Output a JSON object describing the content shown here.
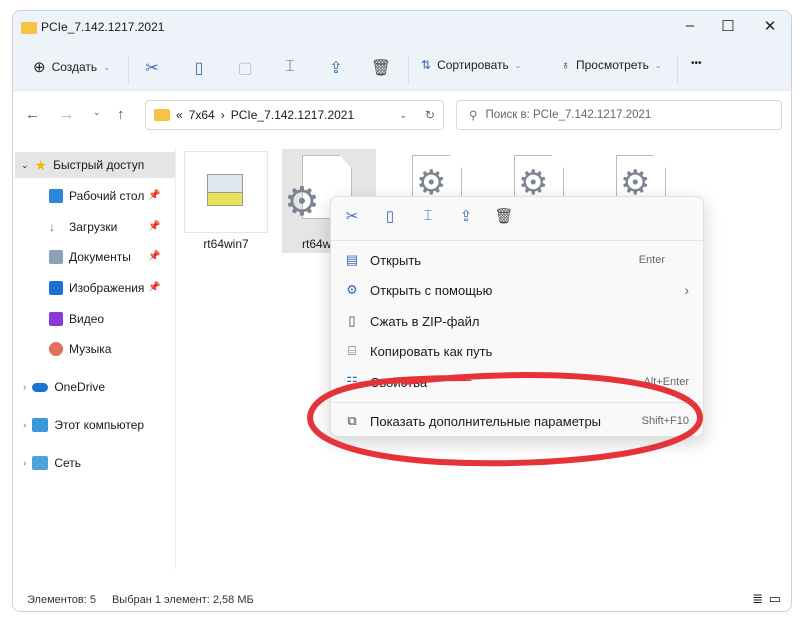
{
  "window": {
    "title": "PCIe_7.142.1217.2021",
    "minimize": "–",
    "maximize": "☐",
    "close": "✕"
  },
  "toolbar": {
    "create": "Создать",
    "sort": "Сортировать",
    "view": "Просмотреть",
    "more": "•••"
  },
  "address": {
    "prefix": "«",
    "parent": "7x64",
    "sep": "›",
    "current": "PCIe_7.142.1217.2021"
  },
  "search": {
    "placeholder": "Поиск в: PCIe_7.142.1217.2021"
  },
  "sidebar": {
    "quick_access": "Быстрый доступ",
    "items": [
      {
        "label": "Рабочий стол",
        "color": "#2b88d8",
        "pinned": true
      },
      {
        "label": "Загрузки",
        "color": "#1aa260",
        "pinned": true
      },
      {
        "label": "Документы",
        "color": "#8da2b8",
        "pinned": true
      },
      {
        "label": "Изображения",
        "color": "#1e6fd0",
        "pinned": true
      },
      {
        "label": "Видео",
        "color": "#8a3ad6",
        "pinned": false
      },
      {
        "label": "Музыка",
        "color": "#e0715a",
        "pinned": false
      }
    ],
    "onedrive": "OneDrive",
    "this_pc": "Этот компьютер",
    "network": "Сеть"
  },
  "files": [
    {
      "name": "rt64win7"
    },
    {
      "name": "rt64w"
    }
  ],
  "context_menu": {
    "items": [
      {
        "label": "Открыть",
        "shortcut": "Enter",
        "icon": "▤"
      },
      {
        "label": "Открыть с помощью",
        "shortcut": "›",
        "icon": "⚙"
      },
      {
        "label": "Сжать в ZIP-файл",
        "shortcut": "",
        "icon": "▯"
      },
      {
        "label": "Копировать как путь",
        "shortcut": "",
        "icon": "⌸"
      },
      {
        "label": "Свойства",
        "shortcut": "Alt+Enter",
        "icon": "☷"
      },
      {
        "label": "Показать дополнительные параметры",
        "shortcut": "Shift+F10",
        "icon": "⧉"
      }
    ]
  },
  "status": {
    "count": "Элементов: 5",
    "selected": "Выбран 1 элемент: 2,58 МБ"
  },
  "annotation_color": "#e4343a"
}
